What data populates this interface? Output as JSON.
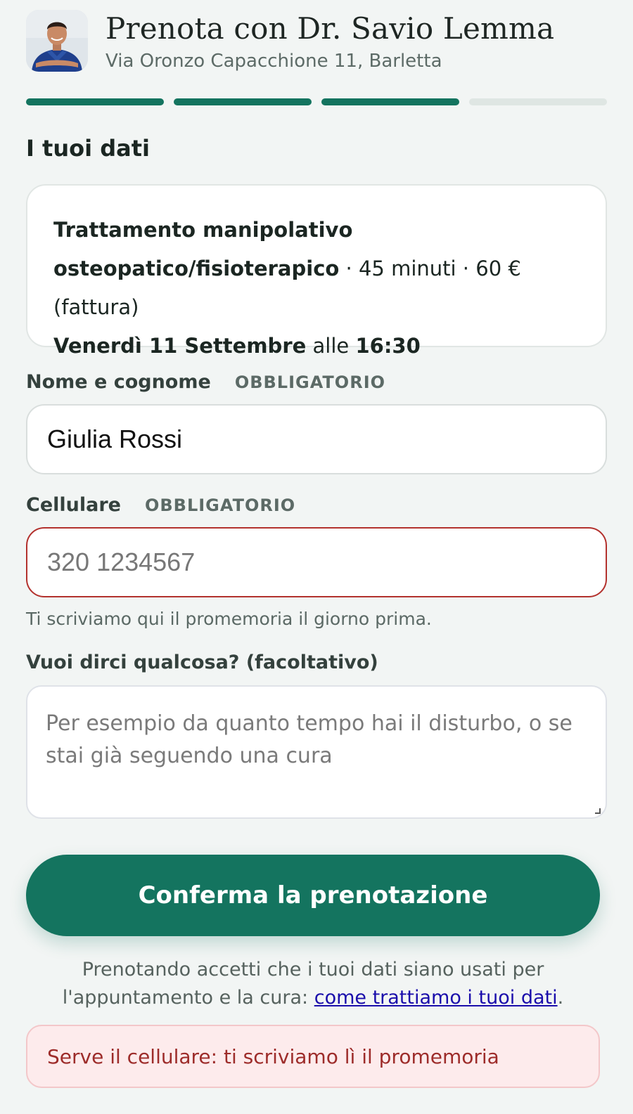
{
  "header": {
    "title": "Prenota con Dr. Savio Lemma",
    "address": "Via Oronzo Capacchione 11, Barletta"
  },
  "progress": {
    "total_steps": 4,
    "completed_steps": 3
  },
  "section_title": "I tuoi dati",
  "summary": {
    "service_line1": "Trattamento manipolativo",
    "service_line2": "osteopatico/fisioterapico",
    "duration": "45 minuti",
    "price": "60 € (fattura)",
    "separator": " · ",
    "date": "Venerdì 11 Settembre",
    "at": "alle",
    "time": "16:30"
  },
  "fields": {
    "name": {
      "label": "Nome e cognome",
      "required": "OBBLIGATORIO",
      "value": "Giulia Rossi"
    },
    "phone": {
      "label": "Cellulare",
      "required": "OBBLIGATORIO",
      "value": "",
      "placeholder": "320 1234567",
      "hint": "Ti scriviamo qui il promemoria il giorno prima."
    },
    "notes": {
      "label": "Vuoi dirci qualcosa? (facoltativo)",
      "value": "",
      "placeholder": "Per esempio da quanto tempo hai il disturbo, o se stai già seguendo una cura"
    }
  },
  "confirm_label": "Conferma la prenotazione",
  "consent": {
    "text": "Prenotando accetti che i tuoi dati siano usati per l'appuntamento e la cura: ",
    "link": "come trattiamo i tuoi dati",
    "end": "."
  },
  "error_message": "Serve il cellulare: ti scriviamo lì il promemoria",
  "colors": {
    "accent": "#14745f",
    "error": "#b3312d",
    "error_bg": "#fdebec",
    "background": "#f2f5f4"
  }
}
